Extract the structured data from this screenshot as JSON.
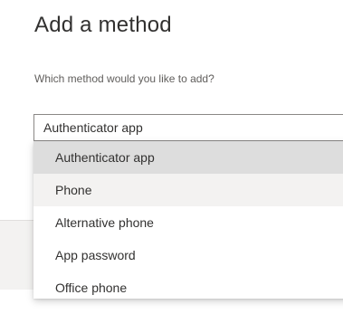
{
  "dialog": {
    "title": "Add a method",
    "prompt": "Which method would you like to add?"
  },
  "method_select": {
    "selected_value": "Authenticator app",
    "options": [
      {
        "label": "Authenticator app",
        "state": "selected"
      },
      {
        "label": "Phone",
        "state": "hovered"
      },
      {
        "label": "Alternative phone",
        "state": "normal"
      },
      {
        "label": "App password",
        "state": "normal"
      },
      {
        "label": "Office phone",
        "state": "normal"
      }
    ]
  },
  "colors": {
    "text": "#323130",
    "subtle_text": "#605e5c",
    "selected_option_bg": "#dddddd",
    "hovered_option_bg": "#f3f2f1",
    "footer_bg": "#f3f2f1",
    "border": "#8a8886"
  }
}
